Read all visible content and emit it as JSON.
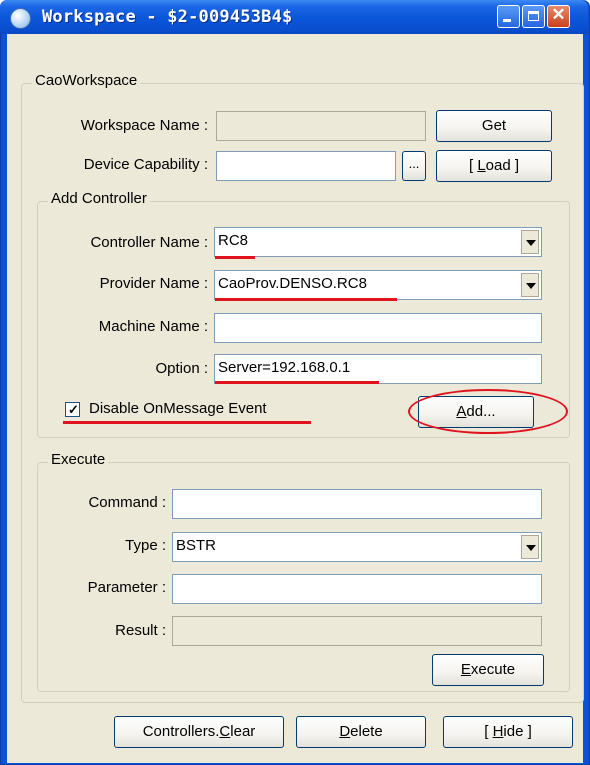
{
  "window": {
    "title": "Workspace - $2-009453B4$"
  },
  "cao_workspace": {
    "legend": "CaoWorkspace",
    "workspace_name_label": "Workspace Name :",
    "workspace_name_value": "",
    "get_button": "Get",
    "device_capability_label": "Device Capability :",
    "device_capability_value": "",
    "browse_button": "...",
    "load_button_pre": "[ ",
    "load_button_access": "L",
    "load_button_post": "oad ]"
  },
  "add_controller": {
    "legend": "Add Controller",
    "controller_name_label": "Controller Name :",
    "controller_name_value": "RC8",
    "provider_name_label": "Provider Name :",
    "provider_name_value": "CaoProv.DENSO.RC8",
    "machine_name_label": "Machine Name :",
    "machine_name_value": "",
    "option_label": "Option :",
    "option_value": "Server=192.168.0.1",
    "disable_event_label": "Disable OnMessage Event",
    "disable_event_checked": true,
    "add_button_access": "A",
    "add_button_post": "dd...",
    "annotation_color": "#e0141e"
  },
  "execute": {
    "legend": "Execute",
    "command_label": "Command :",
    "command_value": "",
    "type_label": "Type :",
    "type_value": "BSTR",
    "parameter_label": "Parameter :",
    "parameter_value": "",
    "result_label": "Result :",
    "result_value": "",
    "execute_button_access": "E",
    "execute_button_post": "xecute"
  },
  "footer": {
    "clear_button_pre": "Controllers.",
    "clear_button_access": "C",
    "clear_button_post": "lear",
    "delete_button_access": "D",
    "delete_button_post": "elete",
    "hide_button_pre": "[ ",
    "hide_button_access": "H",
    "hide_button_post": "ide ]"
  }
}
